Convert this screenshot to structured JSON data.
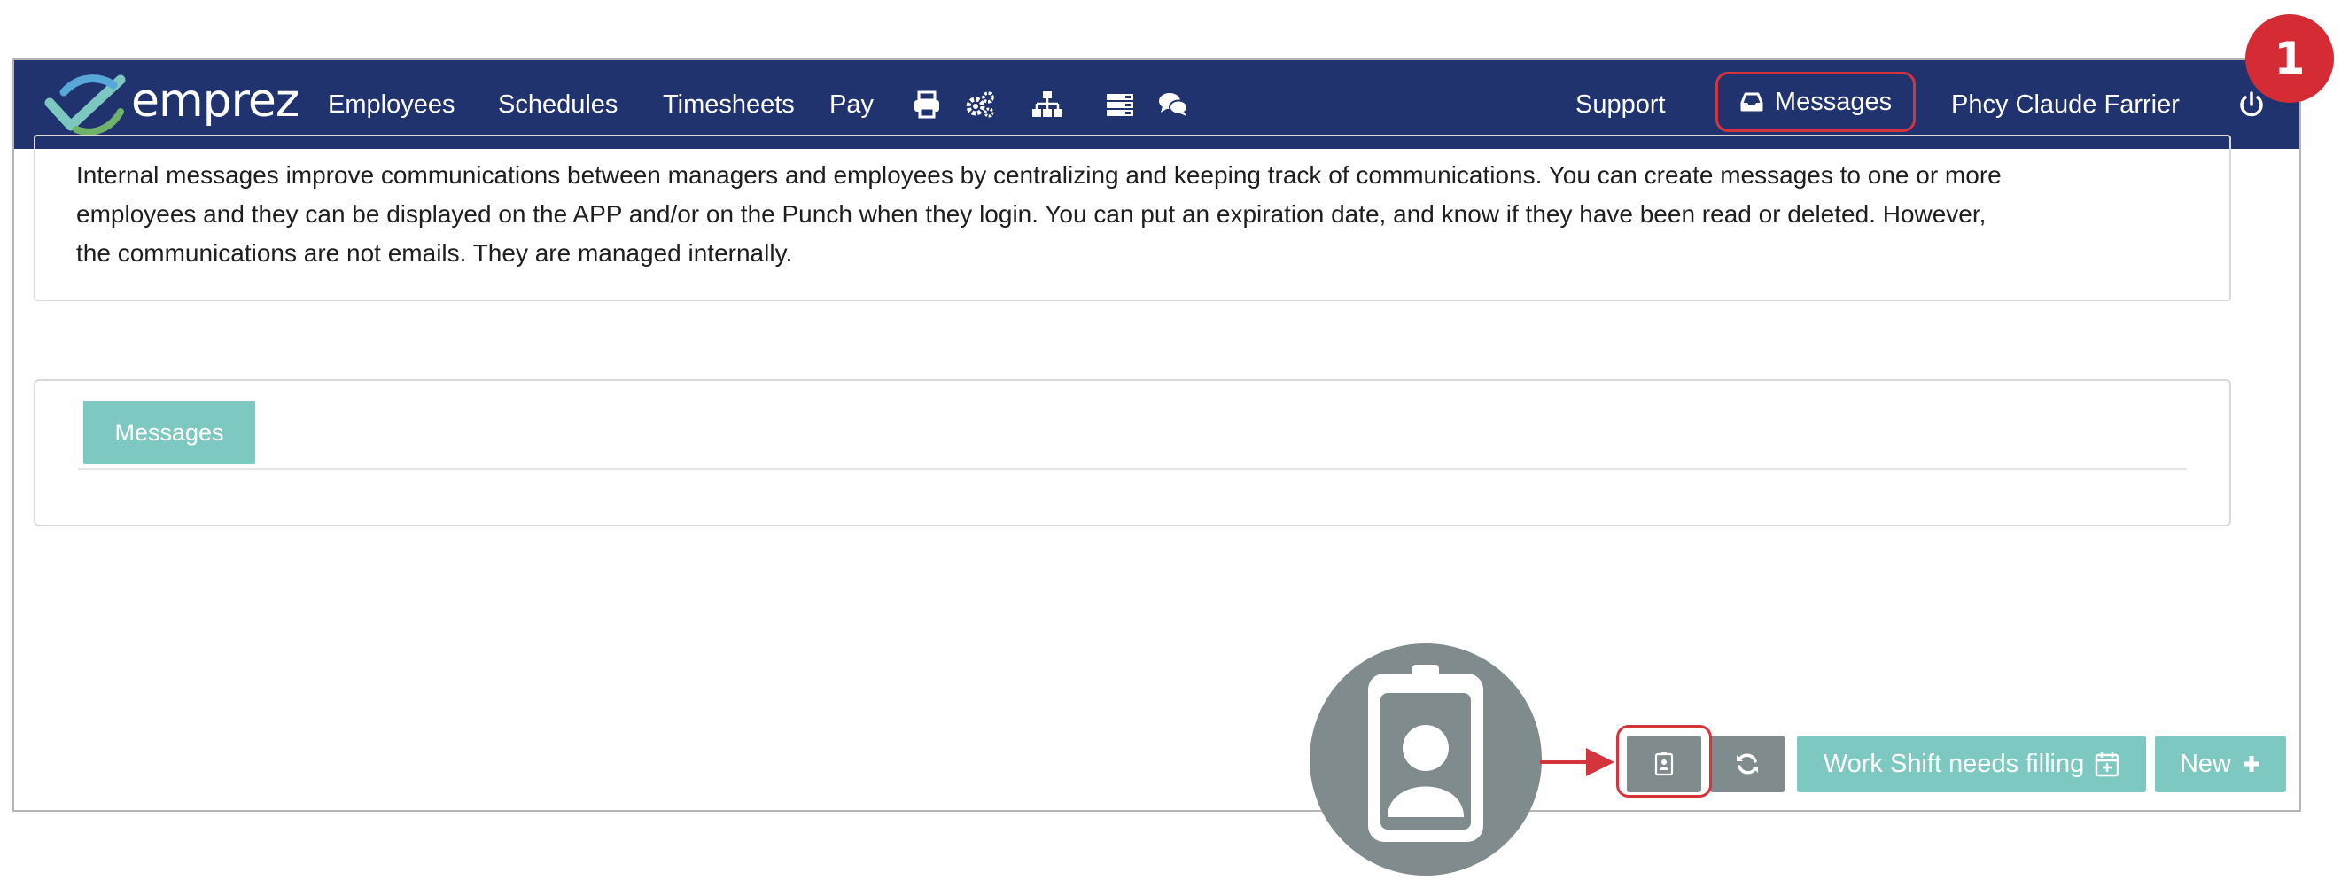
{
  "app": {
    "logo_text": "emprez",
    "brand_colors": {
      "navbar": "#21336f",
      "teal": "#7dc9c1",
      "grey": "#7f8b8c",
      "highlight_red": "#d4343c"
    }
  },
  "nav": {
    "employees": "Employees",
    "schedules": "Schedules",
    "timesheets": "Timesheets",
    "pay": "Pay",
    "icons": [
      "printer-icon",
      "gears-icon",
      "org-chart-icon",
      "server-icon",
      "chat-icon"
    ],
    "support": "Support",
    "messages": "Messages",
    "user": "Phcy Claude Farrier",
    "logout_icon": "power-icon"
  },
  "info": {
    "line1": "Internal messages improve communications between managers and employees by centralizing and keeping track of communications. You can create messages to one or more",
    "line2": "employees and they can be displayed on the APP and/or on the Punch when they login. You can put an expiration date, and know if they have been read or deleted. However,",
    "line3": "the communications are not emails. They are managed internally."
  },
  "tabs": {
    "messages": "Messages"
  },
  "actions": {
    "badge_icon": "id-badge-icon",
    "refresh_icon": "refresh-icon",
    "work_shift": "Work Shift needs filling",
    "new": "New"
  },
  "annotation": {
    "step": "1"
  }
}
